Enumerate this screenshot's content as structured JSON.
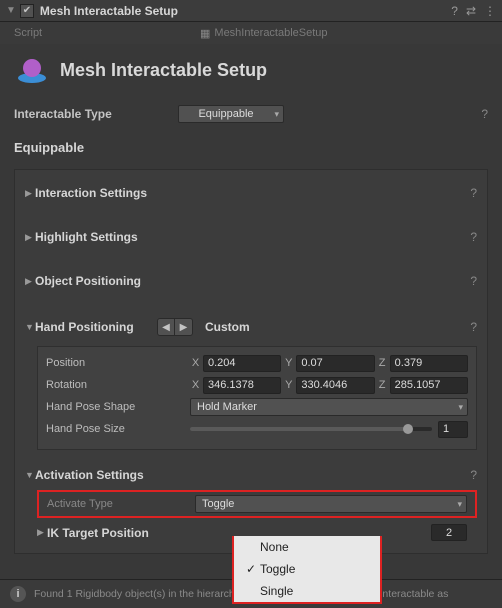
{
  "header": {
    "expanded": true,
    "checked": true,
    "title": "Mesh Interactable Setup",
    "script_label": "Script",
    "script_value": "MeshInteractableSetup",
    "big_title": "Mesh Interactable Setup"
  },
  "interactable_type": {
    "label": "Interactable Type",
    "value": "Equippable"
  },
  "equippable_label": "Equippable",
  "folds": {
    "interaction_settings": "Interaction Settings",
    "highlight_settings": "Highlight Settings",
    "object_positioning": "Object Positioning",
    "hand_positioning": "Hand Positioning",
    "custom": "Custom",
    "activation_settings": "Activation Settings",
    "ik_target_position": "IK Target Position"
  },
  "hand": {
    "position_label": "Position",
    "rotation_label": "Rotation",
    "pose_shape_label": "Hand Pose Shape",
    "pose_size_label": "Hand Pose Size",
    "position": {
      "x": "0.204",
      "y": "0.07",
      "z": "0.379"
    },
    "rotation": {
      "x": "346.1378",
      "y": "330.4046",
      "z": "285.1057"
    },
    "pose_shape": "Hold Marker",
    "pose_size": "1"
  },
  "axes": {
    "x": "X",
    "y": "Y",
    "z": "Z"
  },
  "activate": {
    "label": "Activate Type",
    "value": "Toggle",
    "options": [
      "None",
      "Toggle",
      "Single"
    ]
  },
  "ik_count": "2",
  "footer": "Found 1 Rigidbody object(s) in the hierarchy below that will be individually interactable as"
}
